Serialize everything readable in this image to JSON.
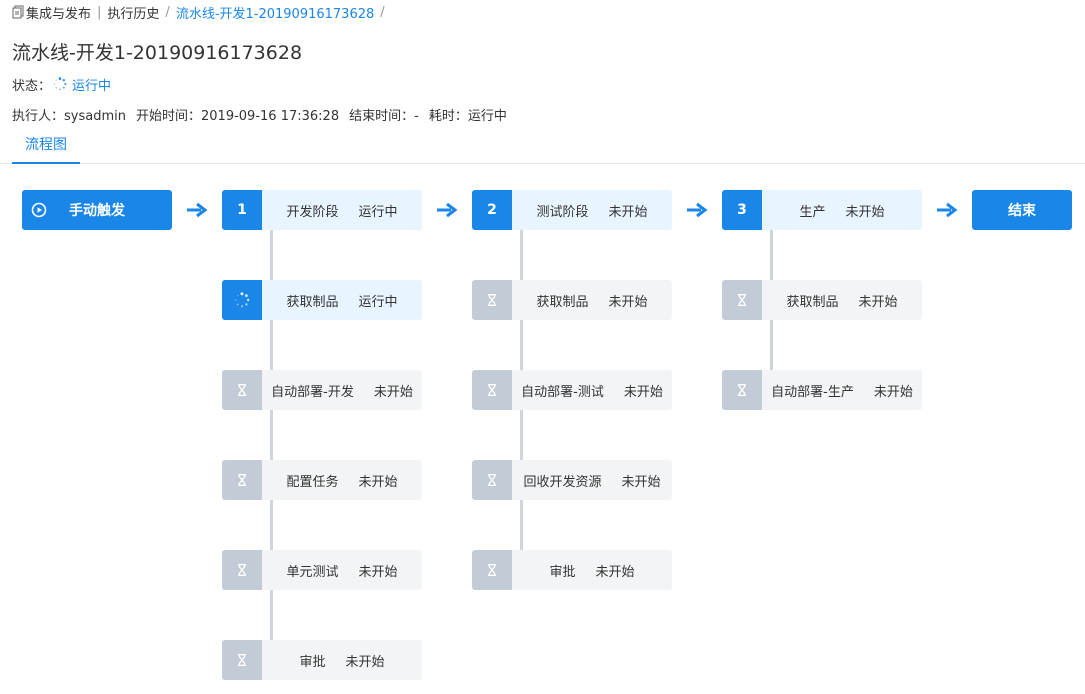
{
  "breadcrumb": {
    "root": "集成与发布",
    "history": "执行历史",
    "current": "流水线-开发1-20190916173628",
    "trailing_sep": "/"
  },
  "page": {
    "title": "流水线-开发1-20190916173628"
  },
  "status": {
    "label": "状态：",
    "value": "运行中"
  },
  "meta": {
    "executor_label": "执行人：",
    "executor": "sysadmin",
    "start_label": "开始时间：",
    "start": "2019-09-16 17:36:28",
    "end_label": "结束时间：",
    "end": "-",
    "duration_label": "耗时：",
    "duration": "运行中"
  },
  "tabs": [
    {
      "label": "流程图",
      "active": true
    }
  ],
  "flow": {
    "trigger": {
      "label": "手动触发",
      "icon": "play-circle-icon"
    },
    "end": {
      "label": "结束"
    },
    "stages": [
      {
        "num": "1",
        "name": "开发阶段",
        "state": "运行中",
        "tasks": [
          {
            "name": "获取制品",
            "state": "运行中",
            "icon": "spinner-icon"
          },
          {
            "name": "自动部署-开发",
            "state": "未开始",
            "icon": "hourglass-icon"
          },
          {
            "name": "配置任务",
            "state": "未开始",
            "icon": "hourglass-icon"
          },
          {
            "name": "单元测试",
            "state": "未开始",
            "icon": "hourglass-icon"
          },
          {
            "name": "审批",
            "state": "未开始",
            "icon": "hourglass-icon"
          }
        ]
      },
      {
        "num": "2",
        "name": "测试阶段",
        "state": "未开始",
        "tasks": [
          {
            "name": "获取制品",
            "state": "未开始",
            "icon": "hourglass-icon"
          },
          {
            "name": "自动部署-测试",
            "state": "未开始",
            "icon": "hourglass-icon"
          },
          {
            "name": "回收开发资源",
            "state": "未开始",
            "icon": "hourglass-icon"
          },
          {
            "name": "审批",
            "state": "未开始",
            "icon": "hourglass-icon"
          }
        ]
      },
      {
        "num": "3",
        "name": "生产",
        "state": "未开始",
        "tasks": [
          {
            "name": "获取制品",
            "state": "未开始",
            "icon": "hourglass-icon"
          },
          {
            "name": "自动部署-生产",
            "state": "未开始",
            "icon": "hourglass-icon"
          }
        ]
      }
    ]
  },
  "colors": {
    "primary": "#1a86e8",
    "running_bg": "#e8f4ff",
    "waiting_icon_bg": "#c3ccd6",
    "waiting_bg": "#f2f4f6",
    "connector": "#d0d5db"
  }
}
